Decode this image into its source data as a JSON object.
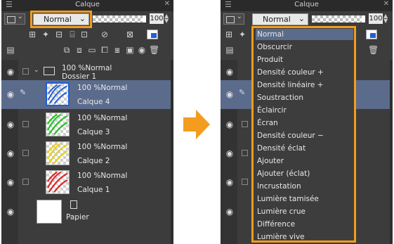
{
  "panel": {
    "title": "Calque",
    "blend_mode": "Normal",
    "opacity": "100",
    "opacity_fraction": 0.94
  },
  "layers": [
    {
      "type": "folder",
      "opacity": "100 %Normal",
      "name": "Dossier 1"
    },
    {
      "type": "layer",
      "opacity": "100 %Normal",
      "name": "Calque 4",
      "color": "#1f5fd6",
      "selected": true
    },
    {
      "type": "layer",
      "opacity": "100 %Normal",
      "name": "Calque 3",
      "color": "#22c022"
    },
    {
      "type": "layer",
      "opacity": "100 %Normal",
      "name": "Calque 2",
      "color": "#e6d21a"
    },
    {
      "type": "layer",
      "opacity": "100 %Normal",
      "name": "Calque 1",
      "color": "#dd2222"
    },
    {
      "type": "paper",
      "name": "Papier"
    }
  ],
  "blend_options": [
    "Normal",
    "Obscurcir",
    "Produit",
    "Densité couleur +",
    "Densité linéaire +",
    "Soustraction",
    "Éclaircir",
    "Écran",
    "Densité couleur −",
    "Densité éclat",
    "Ajouter",
    "Ajouter (éclat)",
    "Incrustation",
    "Lumière tamisée",
    "Lumière crue",
    "Différence",
    "Lumière vive"
  ],
  "selected_option": "Normal",
  "colors": {
    "highlight": "#f39c1d",
    "selection": "#5b6b8c",
    "arrow": "#f39c1d"
  },
  "icons": [
    "menu-grip-icon",
    "close-icon",
    "chevron-down-icon",
    "ruler-icon",
    "clip-icon",
    "reference-icon",
    "draft-icon",
    "lock-icon",
    "lock-alpha-icon",
    "mask-icon",
    "color-icon",
    "new-raster-icon",
    "new-vector-icon",
    "new-folder-icon",
    "merge-icon",
    "mask-add-icon",
    "trash-icon",
    "eye-icon",
    "pen-icon",
    "folder-icon",
    "arrow-right-icon"
  ]
}
